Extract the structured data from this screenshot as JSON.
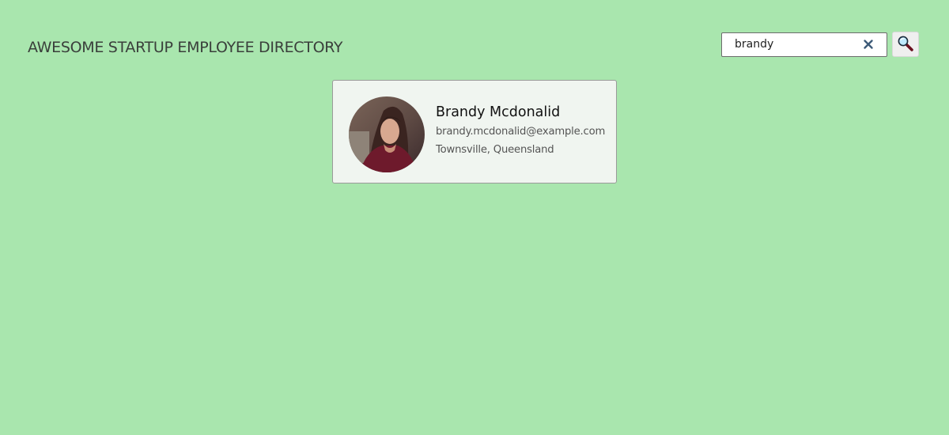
{
  "header": {
    "title": "AWESOME STARTUP EMPLOYEE DIRECTORY"
  },
  "search": {
    "value": "brandy",
    "clear_icon": "close-icon",
    "button_icon": "search-icon"
  },
  "results": [
    {
      "name": "Brandy Mcdonalid",
      "email": "brandy.mcdonalid@example.com",
      "location": "Townsville, Queensland",
      "avatar_icon": "avatar-photo"
    }
  ],
  "colors": {
    "background": "#a9e6ae",
    "card_background": "#f0f5f0",
    "title_text": "#3a3f3b",
    "clear_icon": "#3d5a78"
  }
}
